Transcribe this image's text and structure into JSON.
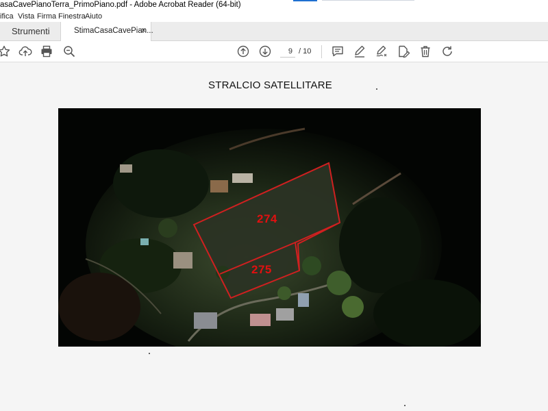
{
  "window": {
    "title": "asaCavePianoTerra_PrimoPiano.pdf - Adobe Acrobat Reader (64-bit)"
  },
  "menu": {
    "items": [
      "ifica",
      "Vista",
      "Firma",
      "Finestra",
      "Aiuto"
    ]
  },
  "tabs": {
    "tools_label": "Strumenti",
    "doc_label": "StimaCasaCavePian...",
    "close_glyph": "×"
  },
  "toolbar": {
    "icons": [
      "star-icon",
      "cloud-upload-icon",
      "print-icon",
      "zoom-out-icon",
      "page-up-icon",
      "page-down-icon",
      "comment-icon",
      "highlight-pen-icon",
      "fill-sign-icon",
      "edit-pdf-icon",
      "delete-icon",
      "rotate-icon"
    ],
    "current_page": "9",
    "total_pages": "/ 10"
  },
  "document": {
    "heading": "STRALCIO SATELLITARE",
    "parcel_labels": [
      "274",
      "275"
    ],
    "parcel_color": "#e11010"
  },
  "colors": {
    "accent": "#1e6fd0"
  }
}
